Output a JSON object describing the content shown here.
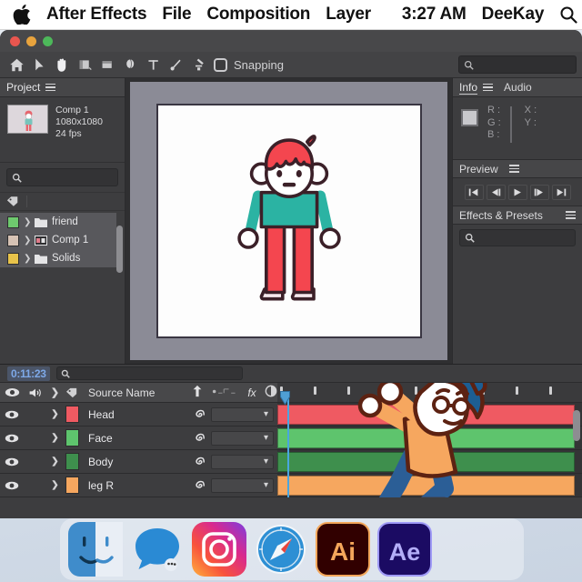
{
  "menubar": {
    "apple_icon": "apple-logo-icon",
    "items": [
      "After Effects",
      "File",
      "Composition",
      "Layer"
    ],
    "time": "3:27 AM",
    "user": "DeeKay",
    "search_icon": "search-icon"
  },
  "window": {
    "traffic_lights": [
      "close",
      "minimize",
      "zoom"
    ]
  },
  "toolbar": {
    "tools": [
      {
        "name": "home-icon",
        "label": "Home"
      },
      {
        "name": "selection-tool-icon",
        "label": "Selection Tool"
      },
      {
        "name": "hand-tool-icon",
        "label": "Hand Tool"
      },
      {
        "name": "zoom-tool-icon",
        "label": "Zoom Tool"
      },
      {
        "name": "anchor-point-tool-icon",
        "label": "Anchor Point Tool"
      },
      {
        "name": "shape-tool-icon",
        "label": "Shape Tool"
      },
      {
        "name": "type-tool-icon",
        "label": "Type Tool"
      },
      {
        "name": "brush-tool-icon",
        "label": "Brush Tool"
      },
      {
        "name": "clone-stamp-tool-icon",
        "label": "Clone Stamp Tool"
      }
    ],
    "snapping_label": "Snapping",
    "snapping_checked": false,
    "search_placeholder": ""
  },
  "project_panel": {
    "tab_label": "Project",
    "menu_icon": "panel-menu-icon",
    "comp": {
      "name": "Comp 1",
      "resolution": "1080x1080",
      "framerate": "24 fps"
    },
    "search_placeholder": "",
    "search_icon": "search-icon",
    "tag_icon": "label-tag-icon",
    "assets": [
      {
        "name": "friend",
        "swatch": "#6ec96e",
        "type": "folder"
      },
      {
        "name": "Comp 1",
        "swatch": "#d6c2b4",
        "type": "composition"
      },
      {
        "name": "Solids",
        "swatch": "#e8c34a",
        "type": "folder"
      }
    ]
  },
  "viewer": {
    "background": "#8b8b96",
    "canvas_background": "#fdfdfd",
    "character": {
      "name": "standing-character",
      "hair": "#f4464f",
      "skin": "#ffffff",
      "shirt": "#2bb3a3",
      "pants": "#f4464f",
      "shoes": "#f2e3e6",
      "outline": "#3b2028"
    }
  },
  "right_panel": {
    "tabs": [
      {
        "label": "Info",
        "active": true
      },
      {
        "label": "Audio",
        "active": false
      }
    ],
    "menu_icon": "panel-menu-icon",
    "info": {
      "r_label": "R :",
      "g_label": "G :",
      "b_label": "B :",
      "x_label": "X :",
      "y_label": "Y :"
    },
    "preview": {
      "title": "Preview",
      "menu_icon": "panel-menu-icon",
      "buttons": [
        {
          "name": "first-frame-button",
          "glyph": "first"
        },
        {
          "name": "previous-frame-button",
          "glyph": "prev"
        },
        {
          "name": "play-button",
          "glyph": "play"
        },
        {
          "name": "next-frame-button",
          "glyph": "next"
        },
        {
          "name": "last-frame-button",
          "glyph": "last"
        }
      ]
    },
    "effects": {
      "title": "Effects & Presets",
      "menu_icon": "panel-menu-icon",
      "search_placeholder": "",
      "search_icon": "search-icon"
    }
  },
  "timeline": {
    "timecode": "0:11:23",
    "search_placeholder": "",
    "search_icon": "search-icon",
    "columns": {
      "eye": "video-visibility-icon",
      "audio": "audio-icon",
      "solo": "solo-toggle-icon",
      "lock": "label-color-icon",
      "source_name": "Source Name",
      "parent_icon": "parent-link-icon",
      "dots_icon": "layer-switches-icon",
      "fx_label": "fx",
      "adjustment_icon": "adjustment-layer-icon"
    },
    "layers": [
      {
        "name": "Head",
        "swatch": "#ef5a62",
        "bar_color": "#ef5a62",
        "visible": true,
        "shy_icon": "shy-spiral-icon",
        "parent": ""
      },
      {
        "name": "Face",
        "swatch": "#5ec46d",
        "bar_color": "#5ec46d",
        "visible": true,
        "shy_icon": "shy-spiral-icon",
        "parent": ""
      },
      {
        "name": "Body",
        "swatch": "#3e8f4d",
        "bar_color": "#3e8f4d",
        "visible": true,
        "shy_icon": "shy-spiral-icon",
        "parent": ""
      },
      {
        "name": "leg R",
        "swatch": "#f6a75f",
        "bar_color": "#f6a75f",
        "visible": true,
        "shy_icon": "shy-spiral-icon",
        "parent": ""
      }
    ],
    "playhead_position_pct": 3,
    "tick_count": 9,
    "dancer": {
      "name": "dancing-character",
      "hair": "#1c5e93",
      "shirt": "#f6a75f",
      "pants": "#2b5e96",
      "shoes": "#d9e2ee",
      "face": "#ffffff",
      "outline": "#5c2212"
    }
  },
  "dock": {
    "items": [
      {
        "name": "finder-icon",
        "label": "Finder"
      },
      {
        "name": "messages-icon",
        "label": "Messages"
      },
      {
        "name": "instagram-icon",
        "label": "Instagram"
      },
      {
        "name": "safari-icon",
        "label": "Safari"
      },
      {
        "name": "illustrator-icon",
        "label": "Ai"
      },
      {
        "name": "after-effects-icon",
        "label": "Ae"
      }
    ]
  }
}
